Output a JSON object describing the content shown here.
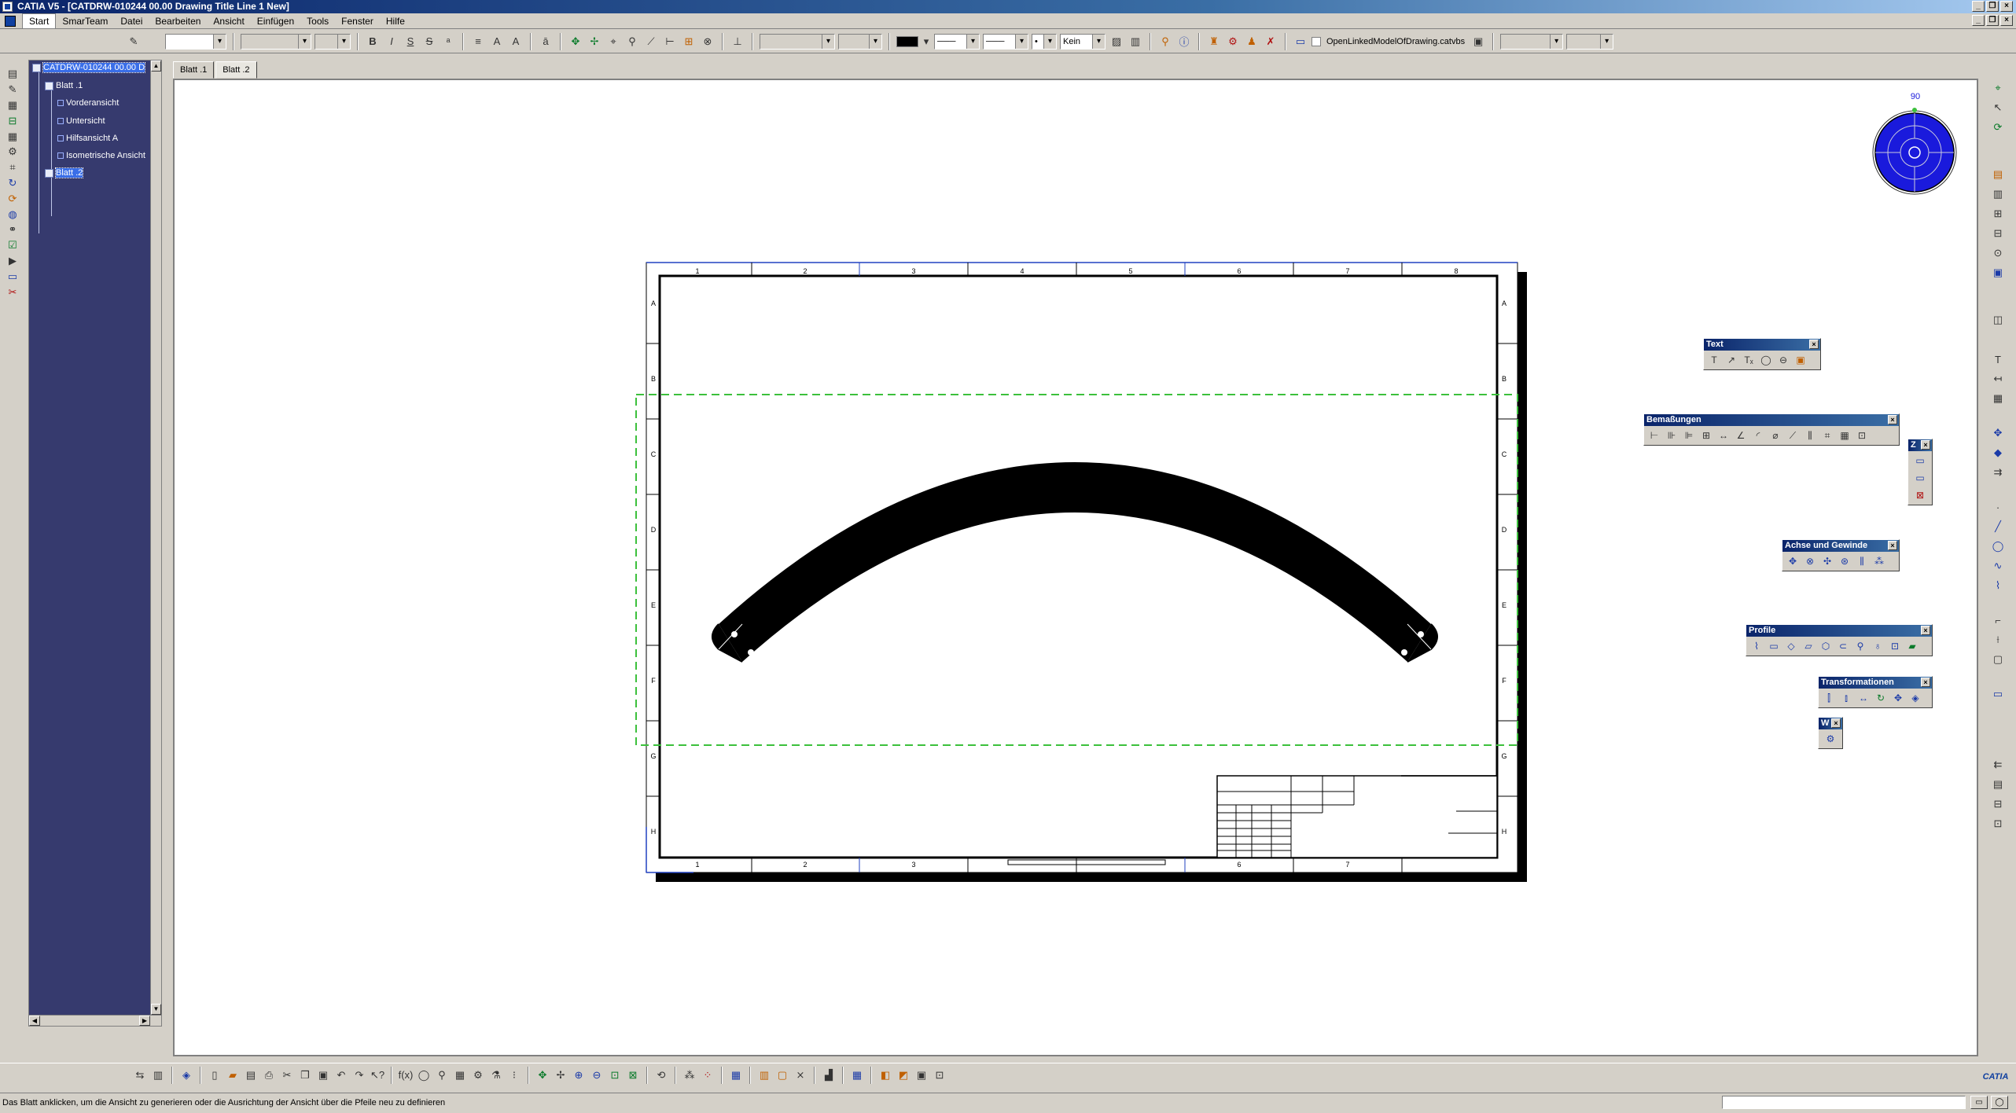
{
  "window": {
    "title": "CATIA V5 - [CATDRW-010244 00.00 Drawing Title Line 1 New]"
  },
  "menu": {
    "items": [
      "Start",
      "SmarTeam",
      "Datei",
      "Bearbeiten",
      "Ansicht",
      "Einfügen",
      "Tools",
      "Fenster",
      "Hilfe"
    ]
  },
  "toolbar": {
    "line_type_value": "Kein",
    "linked_model_label": "OpenLinkedModelOfDrawing.catvbs"
  },
  "tree": {
    "root": "CATDRW-010244 00.00 D",
    "sheet1": "Blatt .1",
    "views": [
      "Vorderansicht",
      "Untersicht",
      "Hilfsansicht A",
      "Isometrische Ansicht"
    ],
    "sheet2": "Blatt .2"
  },
  "tabs": [
    "Blatt .1",
    "Blatt .2"
  ],
  "compass": {
    "angle_label": "90"
  },
  "drawing_frame": {
    "column_labels": [
      "1",
      "2",
      "3",
      "4",
      "5",
      "6",
      "7",
      "8"
    ],
    "row_labels": [
      "A",
      "B",
      "C",
      "D",
      "E",
      "F",
      "G",
      "H"
    ]
  },
  "floating_toolbars": {
    "text": "Text",
    "dimensions": "Bemaßungen",
    "axis_thread": "Achse und Gewinde",
    "profile": "Profile",
    "transformations": "Transformationen",
    "small_z": "Z",
    "small_w": "W"
  },
  "status": {
    "message": "Das Blatt anklicken, um die Ansicht zu generieren oder die Ausrichtung der Ansicht über die Pfeile neu zu definieren"
  },
  "brand": {
    "logo_text": "CATIA"
  },
  "colors": {
    "tree_background": "#363a6e",
    "title_bar": "#0a246a",
    "compass_blue": "#1a1adc",
    "selection_dash": "#3cc03c"
  }
}
